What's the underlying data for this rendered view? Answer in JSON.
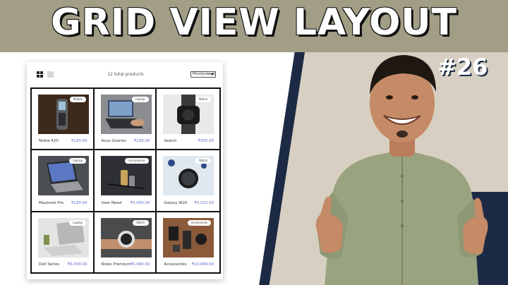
{
  "banner": {
    "title": "GRID VIEW LAYOUT",
    "episode": "#26"
  },
  "colors": {
    "banner_bg": "#a29e85",
    "navy": "#1d2a45",
    "beige": "#d7cfc1",
    "price": "#5b6bc7",
    "shirt": "#9aa37f"
  },
  "app": {
    "toolbar": {
      "grid_view_icon": "grid-icon",
      "list_view_icon": "list-icon",
      "total_products": "12 total products",
      "sort_value": "Price(Lowest)"
    },
    "products": [
      {
        "name": "Nokia 420",
        "price": "₹120.00",
        "tag": "Mobile",
        "icon": "phone"
      },
      {
        "name": "Asus Gseries",
        "price": "₹230.00",
        "tag": "Laptop",
        "icon": "laptop"
      },
      {
        "name": "Iwatch",
        "price": "₹330.00",
        "tag": "Watch",
        "icon": "watch"
      },
      {
        "name": "Macbook Pro",
        "price": "₹120.00",
        "tag": "Laptop",
        "icon": "laptop"
      },
      {
        "name": "User Need",
        "price": "₹3,000.00",
        "tag": "Accessories",
        "icon": "accessory"
      },
      {
        "name": "Galaxy W20",
        "price": "₹3,210.00",
        "tag": "Watch",
        "icon": "watch"
      },
      {
        "name": "Dell Series",
        "price": "₹6,000.00",
        "tag": "Laptop",
        "icon": "laptop"
      },
      {
        "name": "Rolex Premium",
        "price": "₹6,990.00",
        "tag": "Watch",
        "icon": "watch"
      },
      {
        "name": "Accessories",
        "price": "₹10,999.00",
        "tag": "Accessories",
        "icon": "accessory"
      }
    ]
  }
}
